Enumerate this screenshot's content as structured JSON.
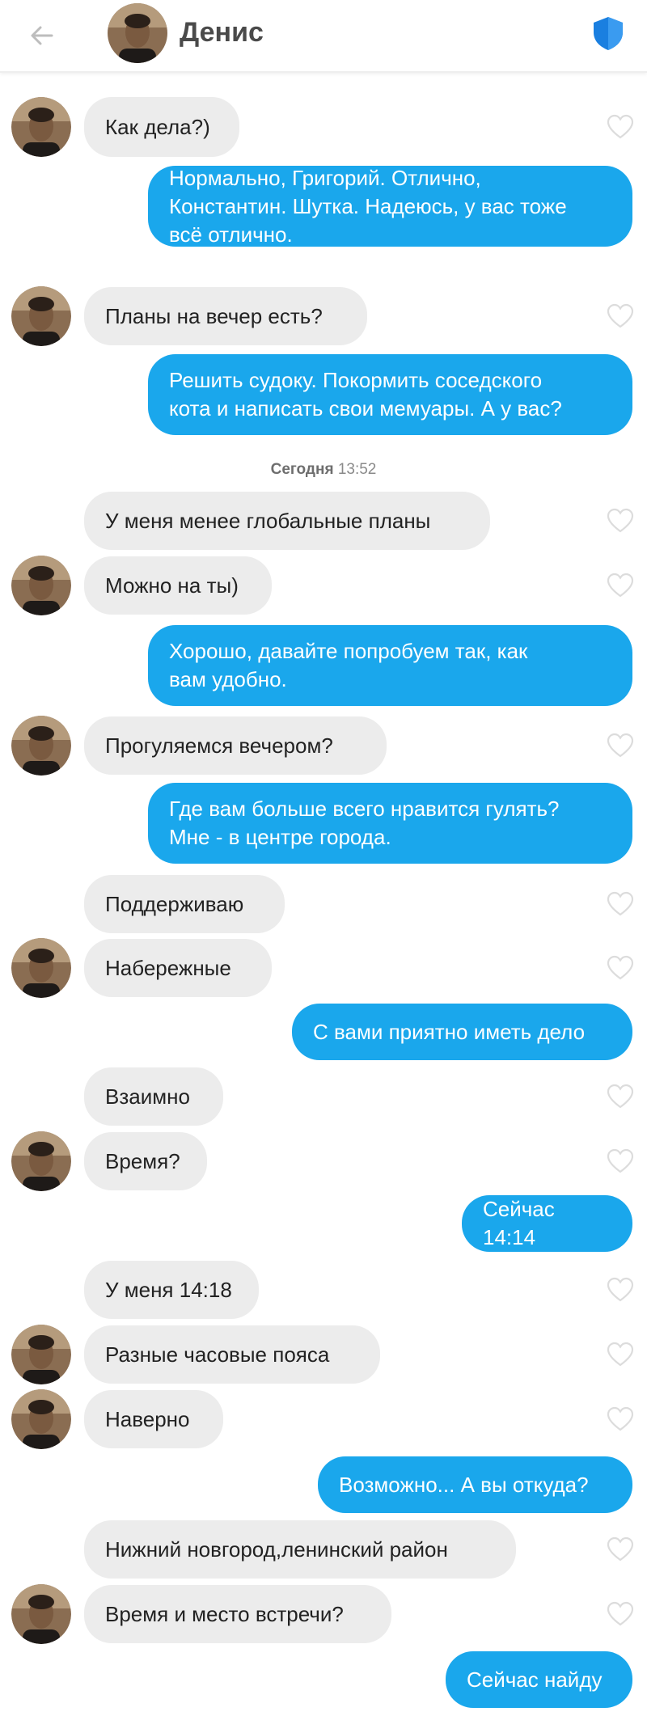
{
  "header": {
    "contact_name": "Денис",
    "back_icon": "arrow-left-icon",
    "shield_icon": "shield-icon",
    "accent_color": "#1aa7ec"
  },
  "timestamp": {
    "label": "Сегодня",
    "time": "13:52"
  },
  "messages": [
    {
      "dir": "in",
      "text": "Как дела?)"
    },
    {
      "dir": "out",
      "text": "Нормально, Григорий. Отлично,\nКонстантин. Шутка. Надеюсь, у вас тоже\nвсё отлично."
    },
    {
      "dir": "in",
      "text": "Планы на вечер есть?"
    },
    {
      "dir": "out",
      "text": "Решить судоку. Покормить соседского\nкота и написать свои мемуары. А у вас?"
    },
    {
      "dir": "in",
      "text": "У меня менее глобальные планы"
    },
    {
      "dir": "in",
      "text": "Можно на ты)"
    },
    {
      "dir": "out",
      "text": "Хорошо, давайте попробуем так, как\nвам удобно."
    },
    {
      "dir": "in",
      "text": "Прогуляемся вечером?"
    },
    {
      "dir": "out",
      "text": "Где вам больше всего нравится гулять?\nМне - в центре города."
    },
    {
      "dir": "in",
      "text": "Поддерживаю"
    },
    {
      "dir": "in",
      "text": "Набережные"
    },
    {
      "dir": "out",
      "text": "С вами приятно иметь дело"
    },
    {
      "dir": "in",
      "text": "Взаимно"
    },
    {
      "dir": "in",
      "text": "Время?"
    },
    {
      "dir": "out",
      "text": "Сейчас 14:14"
    },
    {
      "dir": "in",
      "text": "У меня 14:18"
    },
    {
      "dir": "in",
      "text": "Разные часовые пояса"
    },
    {
      "dir": "in",
      "text": "Наверно"
    },
    {
      "dir": "out",
      "text": "Возможно... А вы откуда?"
    },
    {
      "dir": "in",
      "text": "Нижний новгород,ленинский район"
    },
    {
      "dir": "in",
      "text": "Время и место встречи?"
    },
    {
      "dir": "out",
      "text": "Сейчас найду"
    }
  ]
}
